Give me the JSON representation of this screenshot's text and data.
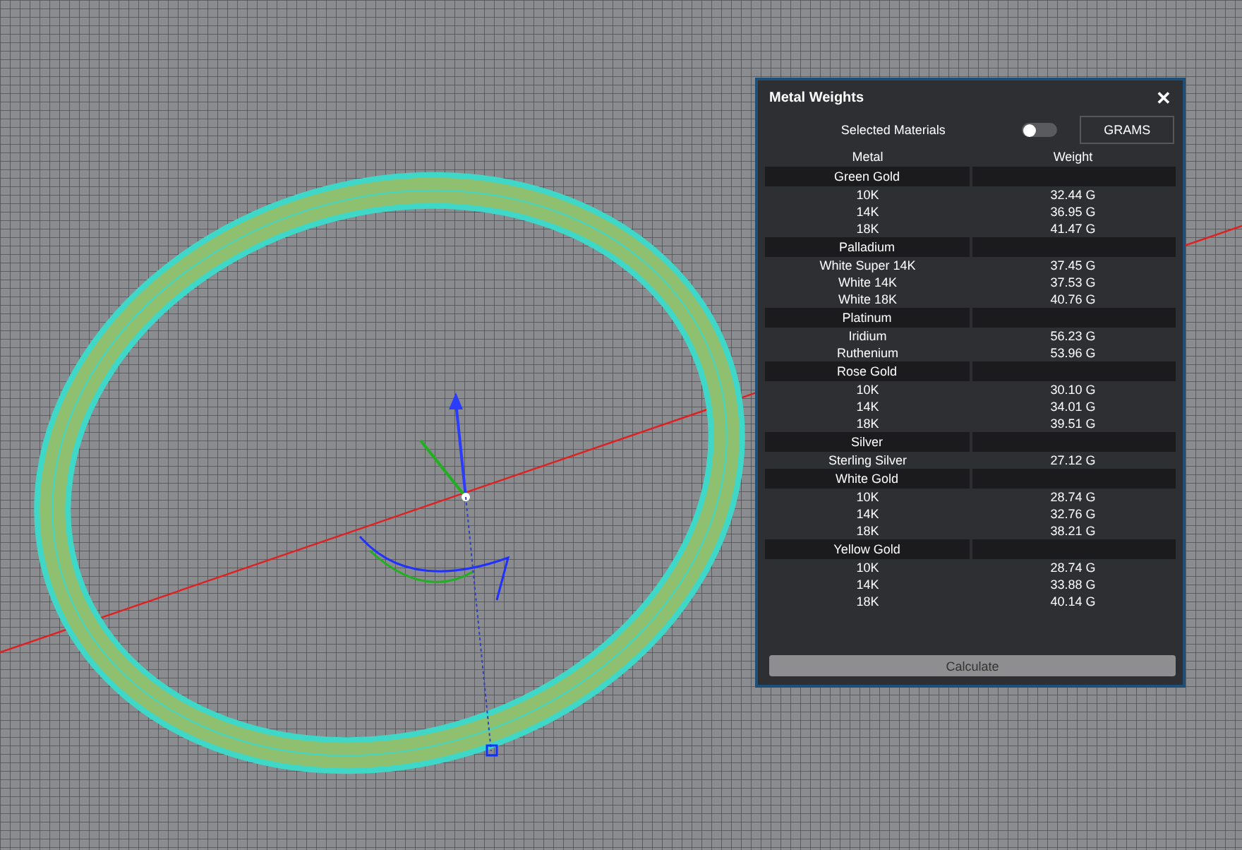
{
  "panel": {
    "title": "Metal Weights",
    "close": "✕",
    "selected_materials": {
      "label": "Selected Materials",
      "on": false
    },
    "units_button": "GRAMS",
    "columns": [
      "Metal",
      "Weight"
    ],
    "groups": [
      {
        "name": "Green Gold",
        "items": [
          {
            "metal": "10K",
            "weight": "32.44 G"
          },
          {
            "metal": "14K",
            "weight": "36.95 G"
          },
          {
            "metal": "18K",
            "weight": "41.47 G"
          }
        ]
      },
      {
        "name": "Palladium",
        "items": [
          {
            "metal": "White Super 14K",
            "weight": "37.45 G"
          },
          {
            "metal": "White 14K",
            "weight": "37.53 G"
          },
          {
            "metal": "White 18K",
            "weight": "40.76 G"
          }
        ]
      },
      {
        "name": "Platinum",
        "items": [
          {
            "metal": "Iridium",
            "weight": "56.23 G"
          },
          {
            "metal": "Ruthenium",
            "weight": "53.96 G"
          }
        ]
      },
      {
        "name": "Rose Gold",
        "items": [
          {
            "metal": "10K",
            "weight": "30.10 G"
          },
          {
            "metal": "14K",
            "weight": "34.01 G"
          },
          {
            "metal": "18K",
            "weight": "39.51 G"
          }
        ]
      },
      {
        "name": "Silver",
        "items": [
          {
            "metal": "Sterling Silver",
            "weight": "27.12 G"
          }
        ]
      },
      {
        "name": "White Gold",
        "items": [
          {
            "metal": "10K",
            "weight": "28.74 G"
          },
          {
            "metal": "14K",
            "weight": "32.76 G"
          },
          {
            "metal": "18K",
            "weight": "38.21 G"
          }
        ]
      },
      {
        "name": "Yellow Gold",
        "items": [
          {
            "metal": "10K",
            "weight": "28.74 G"
          },
          {
            "metal": "14K",
            "weight": "33.88 G"
          },
          {
            "metal": "18K",
            "weight": "40.14 G"
          }
        ]
      }
    ],
    "calculate_button": "Calculate"
  }
}
